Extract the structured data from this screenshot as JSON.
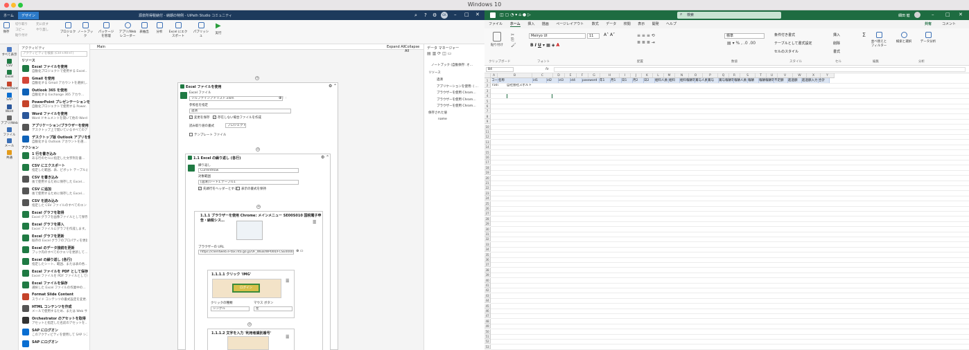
{
  "os_title": "Windows 10",
  "studio": {
    "window_title": "源泉所得税納付 - 納期の特例 - UiPath Studio コミュニティ",
    "tabs": [
      "ホーム",
      "デザイン"
    ],
    "user_initials": "GK",
    "ribbon_small": [
      "切り取り",
      "コピー",
      "貼り付け",
      "元に戻す",
      "やり直し"
    ],
    "ribbon": [
      "保存",
      "プロジェクト",
      "ノートブック",
      "パッケージを管理",
      "アプリ/Web レコーダー",
      "表抽出",
      "分析",
      "Excel にエクスポート",
      "パブリッシュ",
      "実行"
    ],
    "sidebar": [
      "すべて表示",
      "CSV",
      "Excel",
      "PowerPoint",
      "SAP",
      "Word",
      "アプリ/Web",
      "ファイル",
      "メール",
      "共通"
    ],
    "activities_panel": {
      "header": "アクティビティ",
      "search_placeholder": "アクティビティを検索 (Ctrl+Alt+F)",
      "group_resources": "リソース",
      "group_actions": "アクション",
      "items": [
        {
          "title": "Excel ファイルを使用",
          "desc": "自動化プロジェクトで使用する Excel…",
          "color": "#1f7a43"
        },
        {
          "title": "Gmail を使用",
          "desc": "自動化する Gmail アカウントを選択し…",
          "color": "#d44638"
        },
        {
          "title": "Outlook 365 を使用",
          "desc": "自動化する Exchange 365 アカウ…",
          "color": "#0f62b8"
        },
        {
          "title": "PowerPoint プレゼンテーションを使用",
          "desc": "自動化プロジェクトで使用する Power…",
          "color": "#c5432a"
        },
        {
          "title": "Word ファイルを使用",
          "desc": "Word ドキュメントを開いて他の Word…",
          "color": "#2b579a"
        },
        {
          "title": "アプリケーション/ブラウザーを使用",
          "desc": "デスクトップ上で開いているすべてのア…",
          "color": "#555555"
        },
        {
          "title": "デスクトップ版 Outlook アプリを使用",
          "desc": "自動化する Outlook アカウントを選…",
          "color": "#0f62b8"
        },
        {
          "title": "1 行を書き込み",
          "desc": "ある行のセルに指定した文字列を書…",
          "color": "#1f7a43"
        },
        {
          "title": "CSV にエクスポート",
          "desc": "指定した範囲、表、ピボット テーブルま…",
          "color": "#1f7a43"
        },
        {
          "title": "CSV を書き込み",
          "desc": "後で使用するために保存した Excel…",
          "color": "#555555"
        },
        {
          "title": "CSV に追加",
          "desc": "後で使用するために保存した Excel…",
          "color": "#555555"
        },
        {
          "title": "CSV を読み込み",
          "desc": "指定した CSV ファイルのすべてのエント…",
          "color": "#555555"
        },
        {
          "title": "Excel グラフを取得",
          "desc": "Excel グラフを画像ファイルとして保存…",
          "color": "#1f7a43"
        },
        {
          "title": "Excel グラフを挿入",
          "desc": "Excel ファイルにグラフを作成します。け…",
          "color": "#1f7a43"
        },
        {
          "title": "Excel グラフを更新",
          "desc": "既存の Excel グラフのプロパティを更新…",
          "color": "#1f7a43"
        },
        {
          "title": "Excel のデータ接続を更新",
          "desc": "ブック内のすべてのクエリを更新して…",
          "color": "#1f7a43"
        },
        {
          "title": "Excel の繰り返し (各行)",
          "desc": "指定したシート、範囲、または表の各…",
          "color": "#1f7a43"
        },
        {
          "title": "Excel ファイルを PDF として保存",
          "desc": "Excel ファイルを PDF ファイルとして保存…",
          "color": "#1f7a43"
        },
        {
          "title": "Excel ファイルを保存",
          "desc": "選択した Excel ファイルの作業中の…",
          "color": "#1f7a43"
        },
        {
          "title": "Format Slide Content",
          "desc": "スライド コンテンツの書式設定を変更…",
          "color": "#c5432a"
        },
        {
          "title": "HTML コンテンツを作成",
          "desc": "メールで使用するため、または Web サ…",
          "color": "#555555"
        },
        {
          "title": "Orchestrator のアセットを取得",
          "desc": "アセットと指定した名前のアセットを…",
          "color": "#333333"
        },
        {
          "title": "SAP にログオン",
          "desc": "このアクティビティを使用して SAP シス…",
          "color": "#0a6ed1"
        },
        {
          "title": "SAP にログオン",
          "desc": "",
          "color": "#0a6ed1"
        }
      ]
    },
    "designer": {
      "tab": "Main",
      "expand_all": "Expand All",
      "collapse_all": "Collapse All",
      "use_excel": {
        "title": "Excel ファイルを使用",
        "file_label": "Excel ファイル",
        "file_value": "ソルファインアドリスト.xlsm",
        "ref_label": "参照名を指定",
        "ref_value": "過清",
        "save_changes": "変更を保存",
        "create_if_missing": "存在しない場合ファイルを作成",
        "read_format_label": "読み取り値の書式",
        "read_format_value": "プロジェクトの設定",
        "template_file": "テンプレート ファイル"
      },
      "for_each": {
        "title": "1.1 Excel の繰り返し (各行)",
        "iter_label": "繰り返し",
        "iter_value": "CurrentRow",
        "range_label": "対象範囲",
        "range_value": "[過清]シート1.テーブル1",
        "headers": "先頭行をヘッダーとする",
        "keep_format": "表示の書式を保持"
      },
      "browser": {
        "title": "1.1.1 ブラウザーを使用 Chrome: メインメニュー SE00S010 国税電子申告・納税シス…",
        "url_label": "ブラウザーの URL",
        "url_value": "https://clientweb.e-tax.nta.go.jp/UF_WEB/WP000/FCSE00001…"
      },
      "click": {
        "title": "1.1.1.1 クリック 'IMG'",
        "shot_text": "ログイン",
        "click_type_label": "クリックの種類",
        "click_type_value": "シングル",
        "mouse_label": "マウス ボタン",
        "mouse_value": "左"
      },
      "type_into": {
        "title": "1.1.1.2 文字を入力 '利用者識別番号'"
      }
    },
    "data_manager": {
      "title": "データ マネージャー",
      "notebook": "ノートブック (自動保存: オ…",
      "resources": "リソース",
      "res_items": [
        "過清",
        "アプリケーションを使用: ( …",
        "ブラウザーを使用 Chrom…",
        "ブラウザーを使用 Chrom…",
        "ブラウザーを使用 Chrom…"
      ],
      "saved": "保存された値",
      "saved_items": [
        "name"
      ]
    }
  },
  "excel": {
    "user_name": "細田 健",
    "search_placeholder": "検索",
    "share": "共有",
    "comment": "コメント",
    "tabs": [
      "ファイル",
      "ホーム",
      "挿入",
      "描画",
      "ページレイアウト",
      "数式",
      "データ",
      "校閲",
      "表示",
      "開発",
      "ヘルプ"
    ],
    "font_name": "Meiryo UI",
    "font_size": "11",
    "number_format": "標準",
    "ribbon_labels": {
      "paste": "貼り付け",
      "cond_format": "条件付き書式",
      "table_format": "テーブルとして書式設定",
      "cell_style": "セルのスタイル",
      "insert": "挿入",
      "delete": "削除",
      "format": "書式",
      "sort_filter": "並べ替えとフィルター",
      "find_select": "検索と選択",
      "analyze": "データ分析"
    },
    "groups": [
      "クリップボード",
      "フォント",
      "配置",
      "数値",
      "スタイル",
      "セル",
      "編集",
      "分析"
    ],
    "name_box": "B4",
    "fx": "fx",
    "columns": [
      "A",
      "B",
      "C",
      "D",
      "E",
      "F",
      "G",
      "H",
      "I",
      "J",
      "K",
      "L",
      "M",
      "N",
      "O",
      "P",
      "Q",
      "R",
      "S",
      "T",
      "U",
      "V",
      "W",
      "X",
      "Y"
    ],
    "header_row": [
      "コード",
      "名称",
      "",
      "id1",
      "id2",
      "id3",
      "id4",
      "password",
      "年1",
      "月1",
      "日1",
      "月2",
      "日2",
      "給料人員",
      "給料",
      "給料報酬等",
      "賞与人員",
      "賞与",
      "賞与報酬等",
      "報酬人員",
      "報酬",
      "報酬報酬等",
      "不足額",
      "超過額",
      "超過額入力",
      "合計"
    ],
    "data_row": [
      "T501",
      "自社会社スポルト"
    ],
    "row_numbers": [
      "1",
      "2",
      "3",
      "4",
      "5",
      "6",
      "7",
      "8",
      "9",
      "10",
      "11",
      "12",
      "13",
      "14",
      "15",
      "16",
      "17",
      "18",
      "19",
      "20",
      "21",
      "22",
      "23",
      "24",
      "25",
      "26",
      "27",
      "28",
      "29",
      "30",
      "31",
      "32",
      "33",
      "34",
      "35",
      "36",
      "37",
      "38",
      "39",
      "40",
      "41",
      "42",
      "43",
      "44",
      "45",
      "46",
      "47",
      "48",
      "49",
      "50",
      "51",
      "52",
      "53"
    ]
  }
}
